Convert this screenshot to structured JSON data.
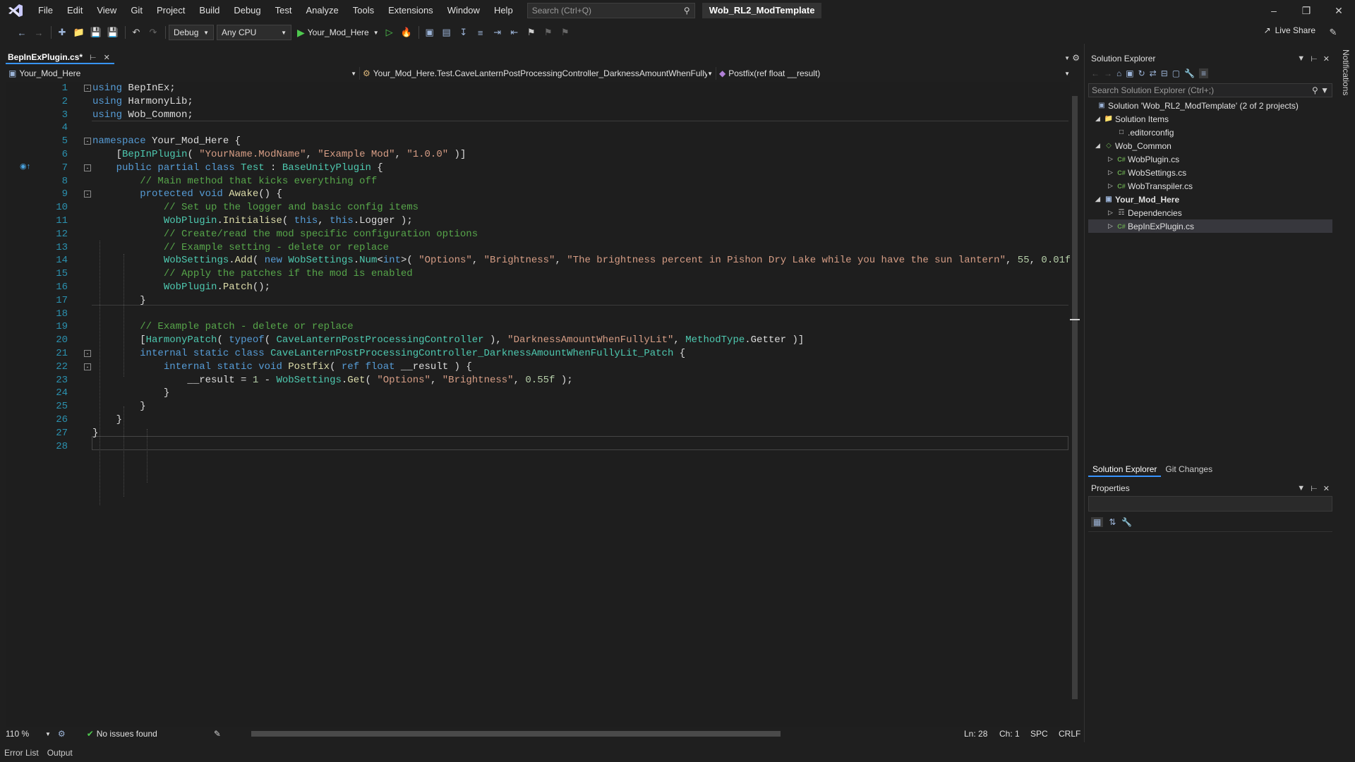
{
  "menu": {
    "items": [
      "File",
      "Edit",
      "View",
      "Git",
      "Project",
      "Build",
      "Debug",
      "Test",
      "Analyze",
      "Tools",
      "Extensions",
      "Window",
      "Help"
    ],
    "search_placeholder": "Search (Ctrl+Q)",
    "solution_name": "Wob_RL2_ModTemplate"
  },
  "toolbar": {
    "config": "Debug",
    "platform": "Any CPU",
    "run_target": "Your_Mod_Here",
    "live_share": "Live Share"
  },
  "document": {
    "tab_label": "BepInExPlugin.cs*",
    "nav_project": "Your_Mod_Here",
    "nav_type": "Your_Mod_Here.Test.CaveLanternPostProcessingController_DarknessAmountWhenFullyL",
    "nav_member": "Postfix(ref float __result)"
  },
  "code_lines": [
    "1",
    "2",
    "3",
    "4",
    "5",
    "6",
    "7",
    "8",
    "9",
    "10",
    "11",
    "12",
    "13",
    "14",
    "15",
    "16",
    "17",
    "18",
    "19",
    "20",
    "21",
    "22",
    "23",
    "24",
    "25",
    "26",
    "27",
    "28"
  ],
  "code": {
    "l1_kw": "using",
    "l1_rest": " BepInEx;",
    "l2_kw": "using",
    "l2_rest": " HarmonyLib;",
    "l3_kw": "using",
    "l3_rest": " Wob_Common;",
    "l5_kw": "namespace",
    "l5_rest": " Your_Mod_Here {",
    "l6_a": "    [",
    "l6_ty": "BepInPlugin",
    "l6_b": "( ",
    "l6_s1": "\"YourName.ModName\"",
    "l6_c": ", ",
    "l6_s2": "\"Example Mod\"",
    "l6_d": ", ",
    "l6_s3": "\"1.0.0\"",
    "l6_e": " )]",
    "l7_a": "    ",
    "l7_kw": "public partial class",
    "l7_b": " ",
    "l7_ty": "Test",
    "l7_c": " : ",
    "l7_ty2": "BaseUnityPlugin",
    "l7_d": " {",
    "l8_cm": "        // Main method that kicks everything off",
    "l9_a": "        ",
    "l9_kw": "protected void",
    "l9_b": " ",
    "l9_mt": "Awake",
    "l9_c": "() {",
    "l10_cm": "            // Set up the logger and basic config items",
    "l11_a": "            ",
    "l11_ty": "WobPlugin",
    "l11_b": ".",
    "l11_mt": "Initialise",
    "l11_c": "( ",
    "l11_kw1": "this",
    "l11_d": ", ",
    "l11_kw2": "this",
    "l11_e": ".Logger );",
    "l12_cm": "            // Create/read the mod specific configuration options",
    "l13_cm": "            // Example setting - delete or replace",
    "l14_a": "            ",
    "l14_ty": "WobSettings",
    "l14_b": ".",
    "l14_mt": "Add",
    "l14_c": "( ",
    "l14_kw": "new",
    "l14_d": " ",
    "l14_ty2": "WobSettings",
    "l14_e": ".",
    "l14_ty3": "Num",
    "l14_f": "<",
    "l14_kw2": "int",
    "l14_g": ">( ",
    "l14_s1": "\"Options\"",
    "l14_h": ", ",
    "l14_s2": "\"Brightness\"",
    "l14_i": ", ",
    "l14_s3": "\"The brightness percent in Pishon Dry Lake while you have the sun lantern\"",
    "l14_j": ", ",
    "l14_n1": "55",
    "l14_k": ", ",
    "l14_n2": "0.01f",
    "l15_cm": "            // Apply the patches if the mod is enabled",
    "l16_a": "            ",
    "l16_ty": "WobPlugin",
    "l16_b": ".",
    "l16_mt": "Patch",
    "l16_c": "();",
    "l17": "        }",
    "l19_cm": "        // Example patch - delete or replace",
    "l20_a": "        [",
    "l20_ty": "HarmonyPatch",
    "l20_b": "( ",
    "l20_kw": "typeof",
    "l20_c": "( ",
    "l20_ty2": "CaveLanternPostProcessingController",
    "l20_d": " ), ",
    "l20_s1": "\"DarknessAmountWhenFullyLit\"",
    "l20_e": ", ",
    "l20_ty3": "MethodType",
    "l20_f": ".Getter )]",
    "l21_a": "        ",
    "l21_kw": "internal static class",
    "l21_b": " ",
    "l21_ty": "CaveLanternPostProcessingController_DarknessAmountWhenFullyLit_Patch",
    "l21_c": " {",
    "l22_a": "            ",
    "l22_kw": "internal static void",
    "l22_b": " ",
    "l22_mt": "Postfix",
    "l22_c": "( ",
    "l22_kw2": "ref float",
    "l22_d": " __result ) {",
    "l23_a": "                __result = ",
    "l23_n1": "1",
    "l23_b": " - ",
    "l23_ty": "WobSettings",
    "l23_c": ".",
    "l23_mt": "Get",
    "l23_d": "( ",
    "l23_s1": "\"Options\"",
    "l23_e": ", ",
    "l23_s2": "\"Brightness\"",
    "l23_f": ", ",
    "l23_n2": "0.55f",
    "l23_g": " );",
    "l24": "            }",
    "l25": "        }",
    "l26": "    }",
    "l27": "}"
  },
  "status": {
    "zoom": "110 %",
    "issues": "No issues found",
    "line": "Ln: 28",
    "col": "Ch: 1",
    "spc": "SPC",
    "eol": "CRLF"
  },
  "bottom_tabs": [
    "Error List",
    "Output"
  ],
  "solution_explorer": {
    "title": "Solution Explorer",
    "search_placeholder": "Search Solution Explorer (Ctrl+;)",
    "solution": "Solution 'Wob_RL2_ModTemplate' (2 of 2 projects)",
    "items": [
      {
        "label": "Solution Items"
      },
      {
        "label": ".editorconfig"
      },
      {
        "label": "Wob_Common"
      },
      {
        "label": "WobPlugin.cs"
      },
      {
        "label": "WobSettings.cs"
      },
      {
        "label": "WobTranspiler.cs"
      },
      {
        "label": "Your_Mod_Here"
      },
      {
        "label": "Dependencies"
      },
      {
        "label": "BepInExPlugin.cs"
      }
    ],
    "tabs": [
      "Solution Explorer",
      "Git Changes"
    ]
  },
  "properties": {
    "title": "Properties"
  },
  "notifications": "Notifications"
}
